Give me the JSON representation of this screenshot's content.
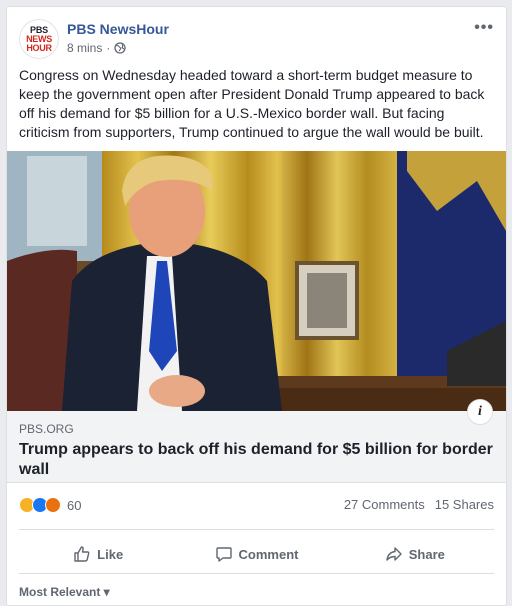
{
  "post": {
    "page_name": "PBS NewsHour",
    "logo": {
      "line1": "PBS",
      "line2": "NEWS",
      "line3": "HOUR"
    },
    "timestamp": "8 mins",
    "separator": "·",
    "body": "Congress on Wednesday headed toward a short-term budget measure to keep the government open after President Donald Trump appeared to back off his demand for $5 billion for a U.S.-Mexico border wall. But facing criticism from supporters, Trump continued to argue the wall would be built.",
    "more_label": "•••"
  },
  "link": {
    "domain": "PBS.ORG",
    "title": "Trump appears to back off his demand for $5 billion for border wall",
    "info_label": "i"
  },
  "stats": {
    "reaction_count": "60",
    "comments": "27 Comments",
    "shares": "15 Shares"
  },
  "actions": {
    "like": "Like",
    "comment": "Comment",
    "share": "Share"
  },
  "comments_sort": "Most Relevant ▾",
  "colors": {
    "link_blue": "#365899",
    "like_blue": "#1877f2",
    "haha_yellow": "#f7b125",
    "angry_orange": "#e9710f"
  }
}
